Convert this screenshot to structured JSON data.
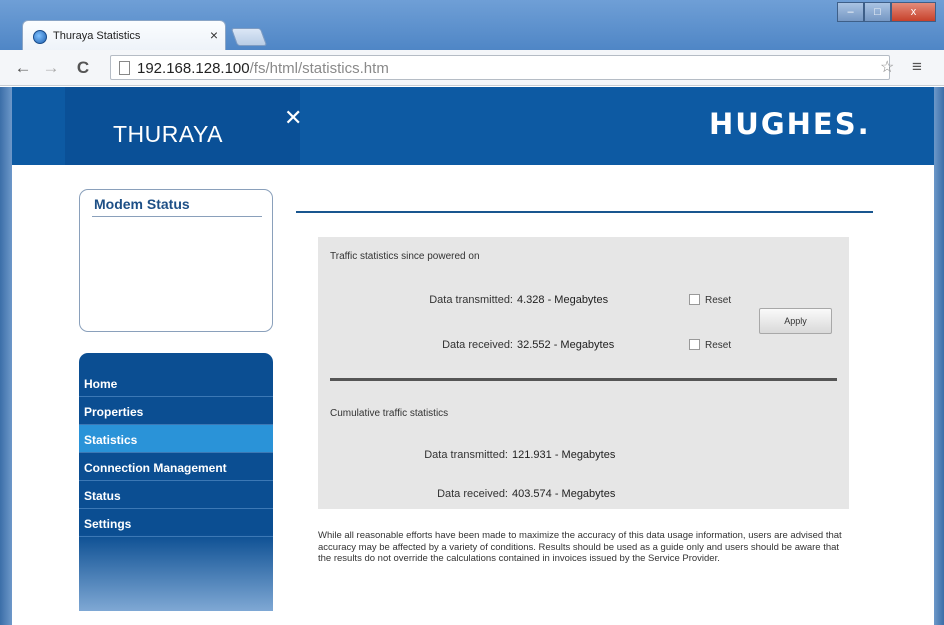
{
  "browser": {
    "tab_title": "Thuraya Statistics",
    "tab_close": "×",
    "url_host": "192.168.128.100",
    "url_path": "/fs/html/statistics.htm",
    "back": "←",
    "forward": "→",
    "reload": "C",
    "star": "☆",
    "menu": "≡",
    "win_min": "–",
    "win_max": "□",
    "win_close": "x"
  },
  "header": {
    "brand_left": "THURAYA",
    "brand_mark": "✕",
    "brand_right": "HUGHES."
  },
  "modem_status": {
    "title": "Modem Status"
  },
  "nav": {
    "items": [
      {
        "label": "Home"
      },
      {
        "label": "Properties"
      },
      {
        "label": "Statistics"
      },
      {
        "label": "Connection Management"
      },
      {
        "label": "Status"
      },
      {
        "label": "Settings"
      }
    ],
    "active": "Statistics"
  },
  "stats": {
    "powered_on_title": "Traffic statistics since powered on",
    "tx_label": "Data transmitted:",
    "tx_value": "4.328 - Megabytes",
    "rx_label": "Data received:",
    "rx_value": "32.552 - Megabytes",
    "reset_label": "Reset",
    "apply_label": "Apply",
    "cumulative_title": "Cumulative traffic statistics",
    "cum_tx_label": "Data transmitted:",
    "cum_tx_value": "121.931 - Megabytes",
    "cum_rx_label": "Data received:",
    "cum_rx_value": "403.574 - Megabytes"
  },
  "disclaimer": "While all reasonable efforts have been made to maximize the accuracy of this data usage information, users are advised that accuracy may be affected by a variety of conditions. Results should be used as a guide only and users should be aware that the results do not override the calculations contained in invoices issued by the Service Provider.",
  "colors": {
    "banner": "#0d5aa3",
    "nav": "#0b4e92",
    "nav_active": "#2a93d8",
    "panel": "#e6e6e6"
  }
}
